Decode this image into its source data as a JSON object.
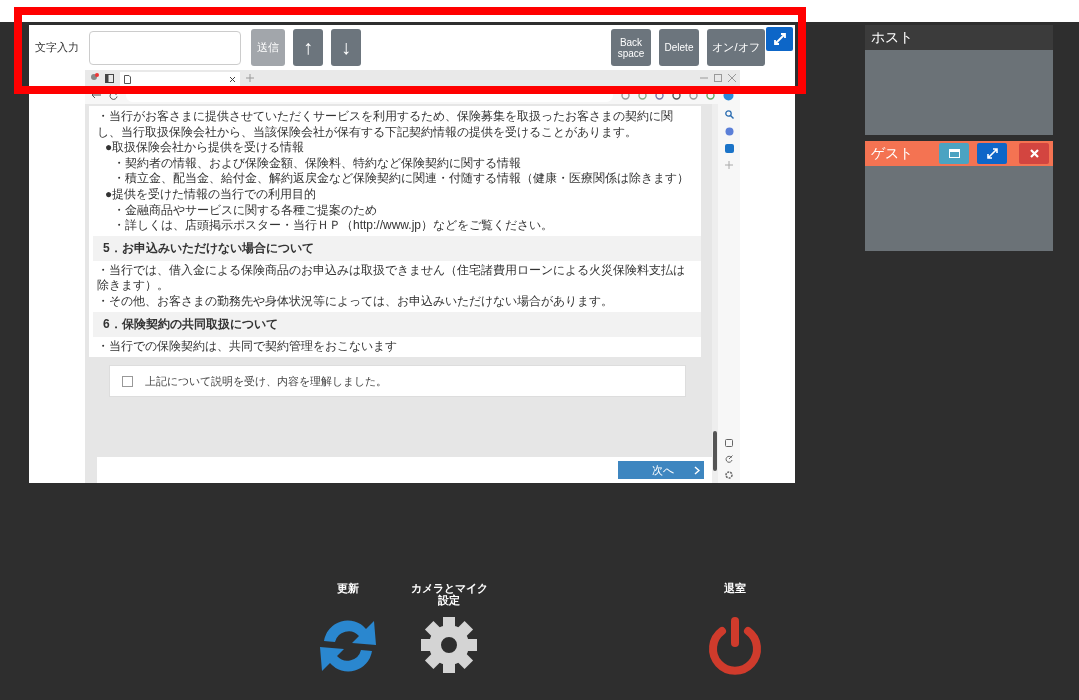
{
  "toolbar": {
    "input_label": "文字入力",
    "left_buttons": [
      {
        "label": "送信",
        "kind": "text",
        "disabled": true
      },
      {
        "label": "↑",
        "kind": "arrow",
        "disabled": false
      },
      {
        "label": "↓",
        "kind": "arrow",
        "disabled": false
      }
    ],
    "right_buttons": [
      {
        "label": "Back space",
        "kind": "small",
        "disabled": false
      },
      {
        "label": "Delete",
        "kind": "small",
        "disabled": false
      },
      {
        "label": "オン/オフ",
        "kind": "text",
        "disabled": false
      }
    ]
  },
  "screen_share": {
    "blocks": [
      {
        "kind": "para",
        "text": "・当行がお客さまに提供させていただくサービスを利用するため、保険募集を取扱ったお客さまの契約に関し、当行取扱保険会社から、当該保険会社が保有する下記契約情報の提供を受けることがあります。"
      },
      {
        "kind": "bullet",
        "text": "●取扱保険会社から提供を受ける情報"
      },
      {
        "kind": "sub",
        "text": "・契約者の情報、および保険金額、保険料、特約など保険契約に関する情報"
      },
      {
        "kind": "sub",
        "text": "・積立金、配当金、給付金、解約返戻金など保険契約に関連・付随する情報（健康・医療関係は除きます）"
      },
      {
        "kind": "bullet",
        "text": "●提供を受けた情報の当行での利用目的"
      },
      {
        "kind": "sub",
        "text": "・金融商品やサービスに関する各種ご提案のため"
      },
      {
        "kind": "sub",
        "text": "・詳しくは、店頭掲示ポスター・当行ＨＰ（http://www.jp）などをご覧ください。"
      },
      {
        "kind": "heading",
        "text": "5．お申込みいただけない場合について"
      },
      {
        "kind": "para",
        "text": "・当行では、借入金による保険商品のお申込みは取扱できません（住宅諸費用ローンによる火災保険料支払は除きます）。"
      },
      {
        "kind": "para",
        "text": "・その他、お客さまの勤務先や身体状況等によっては、お申込みいただけない場合があります。"
      },
      {
        "kind": "heading",
        "text": "6．保険契約の共同取扱について"
      },
      {
        "kind": "para",
        "text": "・当行での保険契約は、共同で契約管理をおこないます"
      }
    ],
    "checkbox": {
      "label": "上記について説明を受け、内容を理解しました。",
      "checked": false
    },
    "next_button": {
      "label": "次へ"
    }
  },
  "participants": [
    {
      "name": "ホスト",
      "kind": "host",
      "color": "#3b3b3b"
    },
    {
      "name": "ゲスト",
      "kind": "guest",
      "color": "#f47352"
    }
  ],
  "controls": [
    {
      "label": "更新",
      "kind": "refresh"
    },
    {
      "label": "カメラとマイク設定",
      "kind": "settings"
    },
    {
      "label": "退室",
      "kind": "exit"
    }
  ]
}
